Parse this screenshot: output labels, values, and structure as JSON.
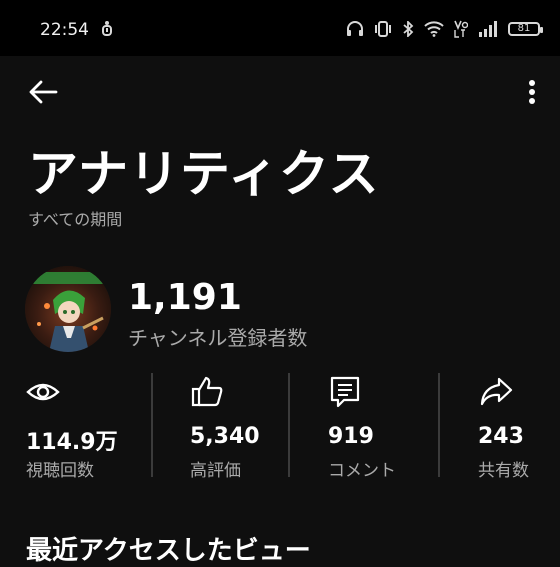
{
  "status_bar": {
    "time": "22:54",
    "battery": "81",
    "left_icon": "app-notification-icon",
    "right_icons": [
      "headphones-icon",
      "vibrate-icon",
      "bluetooth-icon",
      "wifi-icon",
      "volte-icon",
      "signal-icon",
      "battery-icon"
    ]
  },
  "header": {
    "back_icon": "arrow-left-icon",
    "more_icon": "more-vertical-icon"
  },
  "page": {
    "title": "アナリティクス",
    "period": "すべての期間"
  },
  "channel": {
    "subscriber_count": "1,191",
    "subscriber_label": "チャンネル登録者数"
  },
  "stats": [
    {
      "icon": "eye-icon",
      "value": "114.9万",
      "label": "視聴回数"
    },
    {
      "icon": "thumbs-up-icon",
      "value": "5,340",
      "label": "高評価"
    },
    {
      "icon": "comment-icon",
      "value": "919",
      "label": "コメント"
    },
    {
      "icon": "share-icon",
      "value": "243",
      "label": "共有数"
    }
  ],
  "section": {
    "recent_views_title": "最近アクセスしたビュー"
  },
  "colors": {
    "background": "#0f0f0f",
    "status_bar": "#000000",
    "primary_text": "#ffffff",
    "secondary_text": "#aaaaaa",
    "divider": "#3b3b3b"
  }
}
